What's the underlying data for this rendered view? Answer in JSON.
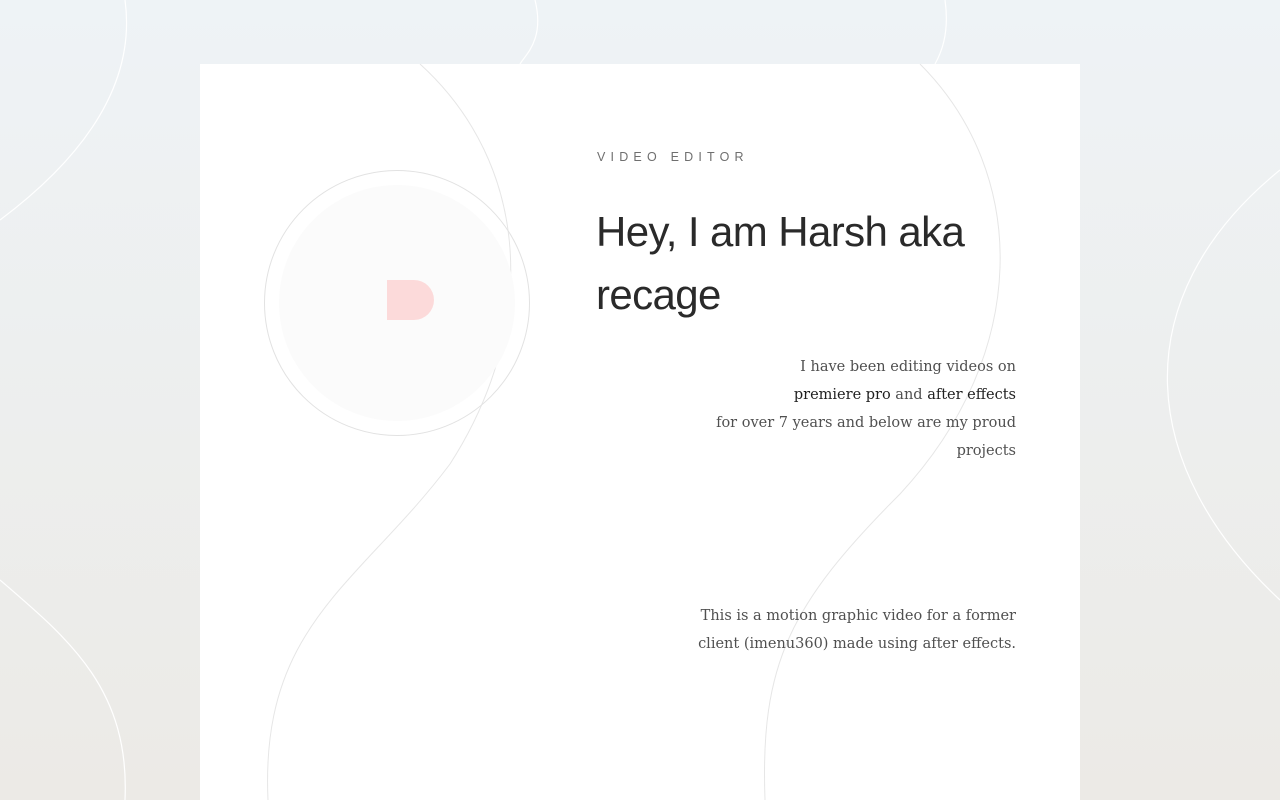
{
  "hero": {
    "role": "VIDEO EDITOR",
    "headline_line1": "Hey, I am Harsh aka",
    "headline_line2": "recage",
    "intro": {
      "line1": "I have been editing videos on",
      "tool1": "premiere pro",
      "joiner": " and ",
      "tool2": "after effects",
      "line3": "for over 7 years and below are my proud",
      "line4": "projects"
    }
  },
  "project": {
    "caption_line1": "This is a motion graphic video for a former",
    "caption_line2": "client (imenu360) made using after effects."
  },
  "avatar": {
    "icon": "d-logo-icon",
    "accent_color": "#fcdada"
  },
  "colors": {
    "card": "#ffffff",
    "text_dark": "#2a2a2a",
    "text_body": "#505050",
    "line": "#e4e4e4"
  }
}
